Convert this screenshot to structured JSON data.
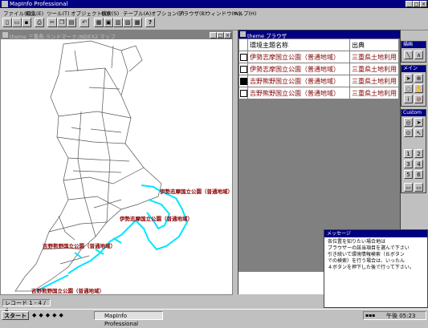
{
  "app": {
    "title": "MapInfo Professional"
  },
  "menu": [
    "ファイル(F)",
    "編集(E)",
    "ツール(T)",
    "オブジェクト(O)",
    "検索(S)",
    "テーブル(A)",
    "オプション(P)",
    "ブラウザ(B)",
    "ウィンドウ(W)",
    "ヘルプ(H)"
  ],
  "map_window": {
    "title": "theme 三重県,ランドマーク,INDEX2 マップ",
    "labels": [
      "伊勢志摩国立公園（普通地域）",
      "伊勢志摩国立公園（普通地域）",
      "吉野熊野国立公園（普通地域）",
      "吉野熊野国立公園（普通地域）"
    ]
  },
  "browser": {
    "title": "theme ブラウザ",
    "columns": [
      "環境主題名称",
      "出典"
    ],
    "rows": [
      {
        "selected": false,
        "name": "伊勢志摩国立公園（普通地域）",
        "source": "三重県土地利用"
      },
      {
        "selected": false,
        "name": "伊勢志摩国立公園（普通地域）",
        "source": "三重県土地利用"
      },
      {
        "selected": true,
        "name": "吉野熊野国立公園（普通地域）",
        "source": "三重県土地利用"
      },
      {
        "selected": false,
        "name": "吉野熊野国立公園（普通地域）",
        "source": "三重県土地利用"
      }
    ]
  },
  "palettes": {
    "drawing": "描画",
    "main": "メイン",
    "custom": "Custom",
    "custom_buttons": [
      "1",
      "2",
      "3",
      "4",
      "5",
      "6"
    ]
  },
  "message": {
    "title": "メッセージ",
    "lines": [
      "各位置を知りたい場合地は",
      "ブラウザーの該当項目を選んで下さい",
      "引き続いて環境情報検索（Ｂボタン",
      "での検索）を行う場合は、いったん",
      "４ボタンを押下した後で行って下さい。"
    ]
  },
  "status": {
    "record": "レコード 1 - 4 / 4"
  },
  "taskbar": {
    "start": "スタート",
    "app": "MapInfo Professional",
    "clock": "午後 05:23"
  },
  "colors": {
    "title_active": "#000080",
    "title_inactive": "#808080",
    "label": "#8b0000",
    "coast": "#00e5ff"
  }
}
